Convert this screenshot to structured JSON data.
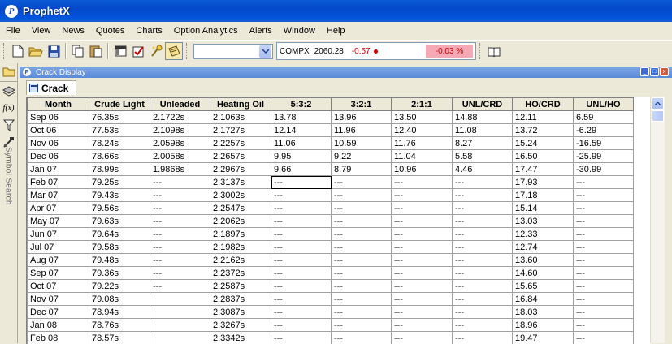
{
  "app": {
    "title": "ProphetX",
    "logo_letter": "P"
  },
  "menu": [
    "File",
    "View",
    "News",
    "Quotes",
    "Charts",
    "Option Analytics",
    "Alerts",
    "Window",
    "Help"
  ],
  "ticker": {
    "symbol": "COMPX",
    "price": "2060.28",
    "change": "-0.57",
    "percent": "-0.03 %"
  },
  "icons": {
    "toolbar": [
      "new-file-icon",
      "open-folder-icon",
      "save-disk-icon",
      "copy-icon",
      "paste-icon",
      "window-icon",
      "checklist-icon",
      "wizard-icon",
      "notepad-icon"
    ],
    "leftbar": [
      "folder-icon",
      "layers-icon",
      "formula-icon",
      "funnel-icon",
      "satellite-icon"
    ],
    "help": "book-icon"
  },
  "leftbar": {
    "formula_glyph": "f(x)",
    "vertical_label": "Symbol Search"
  },
  "window": {
    "title": "Crack Display",
    "tab_label": "Crack",
    "min_glyph": "_",
    "max_glyph": "□",
    "close_glyph": "x"
  },
  "colors": {
    "title_blue": "#0348c9",
    "neg_red": "#cc0000",
    "pct_bg": "#f4a9b4"
  },
  "grid": {
    "columns": [
      "Month",
      "Crude Light",
      "Unleaded",
      "Heating Oil",
      "5:3:2",
      "3:2:1",
      "2:1:1",
      "UNL/CRD",
      "HO/CRD",
      "UNL/HO"
    ],
    "selected": {
      "row": 5,
      "col": 4
    },
    "rows": [
      [
        "Sep 06",
        "76.35s",
        "2.1722s",
        "2.1063s",
        "13.78",
        "13.96",
        "13.50",
        "14.88",
        "12.11",
        "6.59"
      ],
      [
        "Oct 06",
        "77.53s",
        "2.1098s",
        "2.1727s",
        "12.14",
        "11.96",
        "12.40",
        "11.08",
        "13.72",
        "-6.29"
      ],
      [
        "Nov 06",
        "78.24s",
        "2.0598s",
        "2.2257s",
        "11.06",
        "10.59",
        "11.76",
        "8.27",
        "15.24",
        "-16.59"
      ],
      [
        "Dec 06",
        "78.66s",
        "2.0058s",
        "2.2657s",
        "9.95",
        "9.22",
        "11.04",
        "5.58",
        "16.50",
        "-25.99"
      ],
      [
        "Jan 07",
        "78.99s",
        "1.9868s",
        "2.2967s",
        "9.66",
        "8.79",
        "10.96",
        "4.46",
        "17.47",
        "-30.99"
      ],
      [
        "Feb 07",
        "79.25s",
        "---",
        "2.3137s",
        "---",
        "---",
        "---",
        "---",
        "17.93",
        "---"
      ],
      [
        "Mar 07",
        "79.43s",
        "---",
        "2.3002s",
        "---",
        "---",
        "---",
        "---",
        "17.18",
        "---"
      ],
      [
        "Apr 07",
        "79.56s",
        "---",
        "2.2547s",
        "---",
        "---",
        "---",
        "---",
        "15.14",
        "---"
      ],
      [
        "May 07",
        "79.63s",
        "---",
        "2.2062s",
        "---",
        "---",
        "---",
        "---",
        "13.03",
        "---"
      ],
      [
        "Jun 07",
        "79.64s",
        "---",
        "2.1897s",
        "---",
        "---",
        "---",
        "---",
        "12.33",
        "---"
      ],
      [
        "Jul 07",
        "79.58s",
        "---",
        "2.1982s",
        "---",
        "---",
        "---",
        "---",
        "12.74",
        "---"
      ],
      [
        "Aug 07",
        "79.48s",
        "---",
        "2.2162s",
        "---",
        "---",
        "---",
        "---",
        "13.60",
        "---"
      ],
      [
        "Sep 07",
        "79.36s",
        "---",
        "2.2372s",
        "---",
        "---",
        "---",
        "---",
        "14.60",
        "---"
      ],
      [
        "Oct 07",
        "79.22s",
        "---",
        "2.2587s",
        "---",
        "---",
        "---",
        "---",
        "15.65",
        "---"
      ],
      [
        "Nov 07",
        "79.08s",
        "",
        "2.2837s",
        "---",
        "---",
        "---",
        "---",
        "16.84",
        "---"
      ],
      [
        "Dec 07",
        "78.94s",
        "",
        "2.3087s",
        "---",
        "---",
        "---",
        "---",
        "18.03",
        "---"
      ],
      [
        "Jan 08",
        "78.76s",
        "",
        "2.3267s",
        "---",
        "---",
        "---",
        "---",
        "18.96",
        "---"
      ],
      [
        "Feb 08",
        "78.57s",
        "",
        "2.3342s",
        "---",
        "---",
        "---",
        "---",
        "19.47",
        "---"
      ]
    ]
  }
}
